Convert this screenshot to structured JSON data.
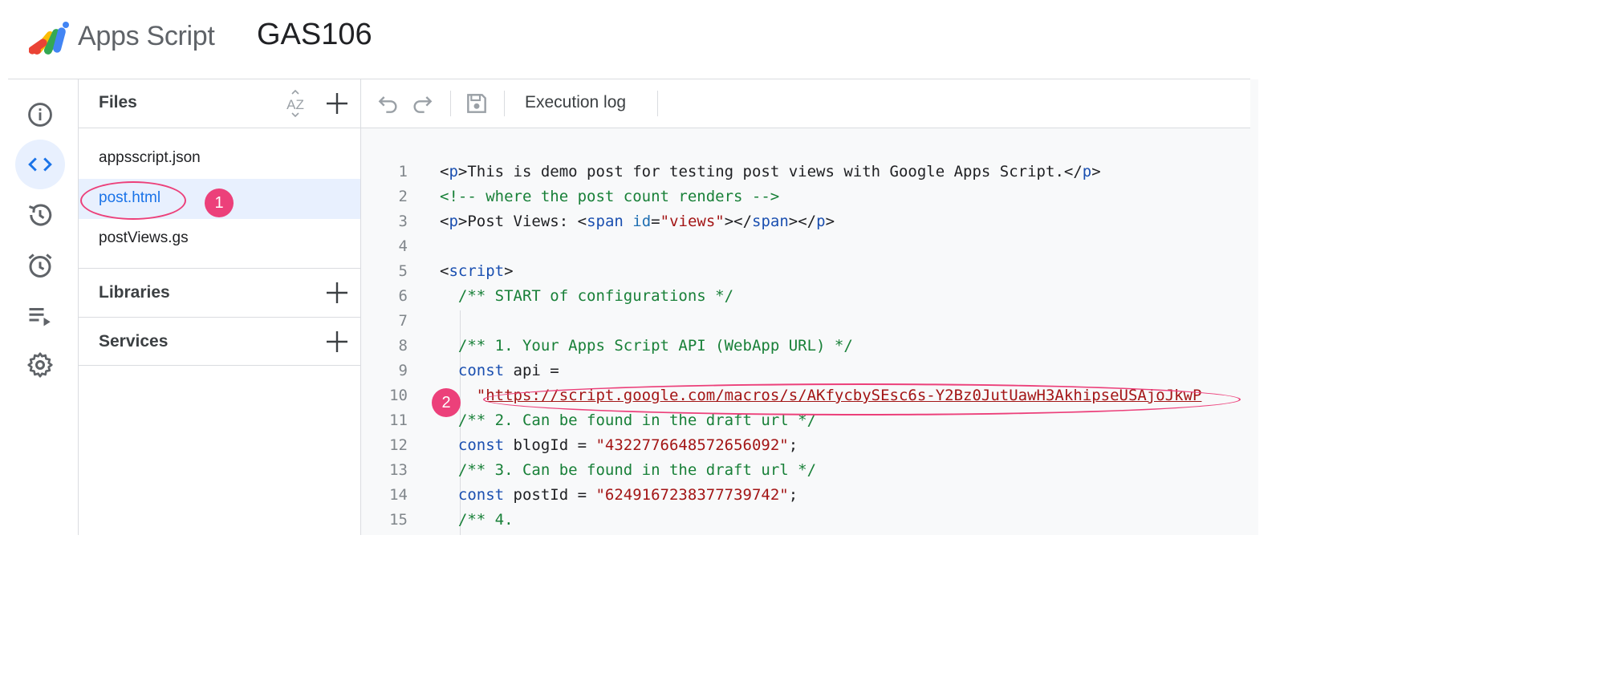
{
  "header": {
    "brand": "Apps Script",
    "project_name": "GAS106"
  },
  "rail": {
    "items": [
      {
        "icon": "info-icon"
      },
      {
        "icon": "code-icon",
        "active": true
      },
      {
        "icon": "history-icon"
      },
      {
        "icon": "alarm-icon"
      },
      {
        "icon": "executions-icon"
      },
      {
        "icon": "gear-icon"
      }
    ]
  },
  "files_panel": {
    "title": "Files",
    "sort_label": "AZ",
    "files": [
      {
        "name": "appsscript.json"
      },
      {
        "name": "post.html",
        "active": true
      },
      {
        "name": "postViews.gs"
      }
    ],
    "sections": [
      {
        "title": "Libraries"
      },
      {
        "title": "Services"
      }
    ]
  },
  "toolbar": {
    "execution_log": "Execution log"
  },
  "annotations": {
    "badge_1": "1",
    "badge_2": "2"
  },
  "colors": {
    "accent": "#1a73e8",
    "annotation": "#ec407a",
    "active_bg": "#e8f0fe"
  },
  "code": {
    "lines": [
      {
        "n": "1",
        "tokens": [
          [
            "p",
            "<"
          ],
          [
            "tag",
            "p"
          ],
          [
            "p",
            ">This is demo post for testing post views with Google Apps Script.</"
          ],
          [
            "tag",
            "p"
          ],
          [
            "p",
            ">"
          ]
        ]
      },
      {
        "n": "2",
        "tokens": [
          [
            "com",
            "<!-- where the post count renders -->"
          ]
        ]
      },
      {
        "n": "3",
        "tokens": [
          [
            "p",
            "<"
          ],
          [
            "tag",
            "p"
          ],
          [
            "p",
            ">Post Views: <"
          ],
          [
            "tag",
            "span"
          ],
          [
            "p",
            " "
          ],
          [
            "attr",
            "id"
          ],
          [
            "p",
            "="
          ],
          [
            "str",
            "\"views\""
          ],
          [
            "p",
            "></"
          ],
          [
            "tag",
            "span"
          ],
          [
            "p",
            "></"
          ],
          [
            "tag",
            "p"
          ],
          [
            "p",
            ">"
          ]
        ]
      },
      {
        "n": "4",
        "tokens": []
      },
      {
        "n": "5",
        "tokens": [
          [
            "p",
            "<"
          ],
          [
            "tag",
            "script"
          ],
          [
            "p",
            ">"
          ]
        ]
      },
      {
        "n": "6",
        "tokens": [
          [
            "p",
            "  "
          ],
          [
            "com",
            "/** START of configurations */"
          ]
        ]
      },
      {
        "n": "7",
        "tokens": []
      },
      {
        "n": "8",
        "tokens": [
          [
            "p",
            "  "
          ],
          [
            "com",
            "/** 1. Your Apps Script API (WebApp URL) */"
          ]
        ]
      },
      {
        "n": "9",
        "tokens": [
          [
            "p",
            "  "
          ],
          [
            "kw",
            "const"
          ],
          [
            "p",
            " api ="
          ]
        ]
      },
      {
        "n": "10",
        "tokens": [
          [
            "p",
            "    "
          ],
          [
            "str",
            "\""
          ],
          [
            "url",
            "https://script.google.com/macros/s/AKfycbySEsc6s-Y2Bz0JutUawH3AkhipseUSAjoJkwP"
          ]
        ]
      },
      {
        "n": "11",
        "tokens": [
          [
            "p",
            "  "
          ],
          [
            "com",
            "/** 2. Can be found in the draft url */"
          ]
        ]
      },
      {
        "n": "12",
        "tokens": [
          [
            "p",
            "  "
          ],
          [
            "kw",
            "const"
          ],
          [
            "p",
            " blogId = "
          ],
          [
            "str",
            "\"4322776648572656092\""
          ],
          [
            "p",
            ";"
          ]
        ]
      },
      {
        "n": "13",
        "tokens": [
          [
            "p",
            "  "
          ],
          [
            "com",
            "/** 3. Can be found in the draft url */"
          ]
        ]
      },
      {
        "n": "14",
        "tokens": [
          [
            "p",
            "  "
          ],
          [
            "kw",
            "const"
          ],
          [
            "p",
            " postId = "
          ],
          [
            "str",
            "\"6249167238377739742\""
          ],
          [
            "p",
            ";"
          ]
        ]
      },
      {
        "n": "15",
        "tokens": [
          [
            "p",
            "  "
          ],
          [
            "com",
            "/** 4."
          ]
        ]
      }
    ]
  }
}
